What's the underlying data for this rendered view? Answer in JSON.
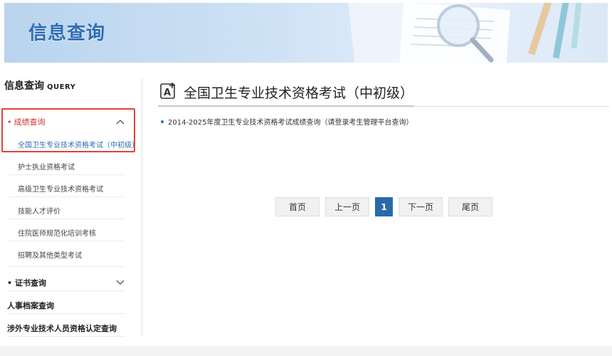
{
  "banner": {
    "title": "信息查询"
  },
  "sidebar": {
    "title": "信息查询",
    "title_en": "QUERY",
    "groups": [
      {
        "label": "成绩查询",
        "expanded": true,
        "items": [
          {
            "label": "全国卫生专业技术资格考试（中初级）",
            "active": true
          },
          {
            "label": "护士执业资格考试"
          },
          {
            "label": "高级卫生专业技术资格考试"
          },
          {
            "label": "技能人才评价"
          },
          {
            "label": "住院医师规范化培训考核"
          },
          {
            "label": "招聘及其他类型考试"
          }
        ]
      },
      {
        "label": "证书查询",
        "expanded": false
      },
      {
        "label": "人事档案查询"
      },
      {
        "label": "涉外专业技术人员资格认定查询"
      }
    ]
  },
  "main": {
    "title": "全国卫生专业技术资格考试（中初级）",
    "list": [
      {
        "text": "2014-2025年度卫生专业技术资格考试成绩查询（请登录考生管理平台查询）"
      }
    ],
    "pager": {
      "first": "首页",
      "prev": "上一页",
      "current": "1",
      "next": "下一页",
      "last": "尾页"
    }
  },
  "colors": {
    "accent_blue": "#2a6aaa",
    "highlight_red": "#e0423c",
    "active_text": "#c8382f"
  }
}
